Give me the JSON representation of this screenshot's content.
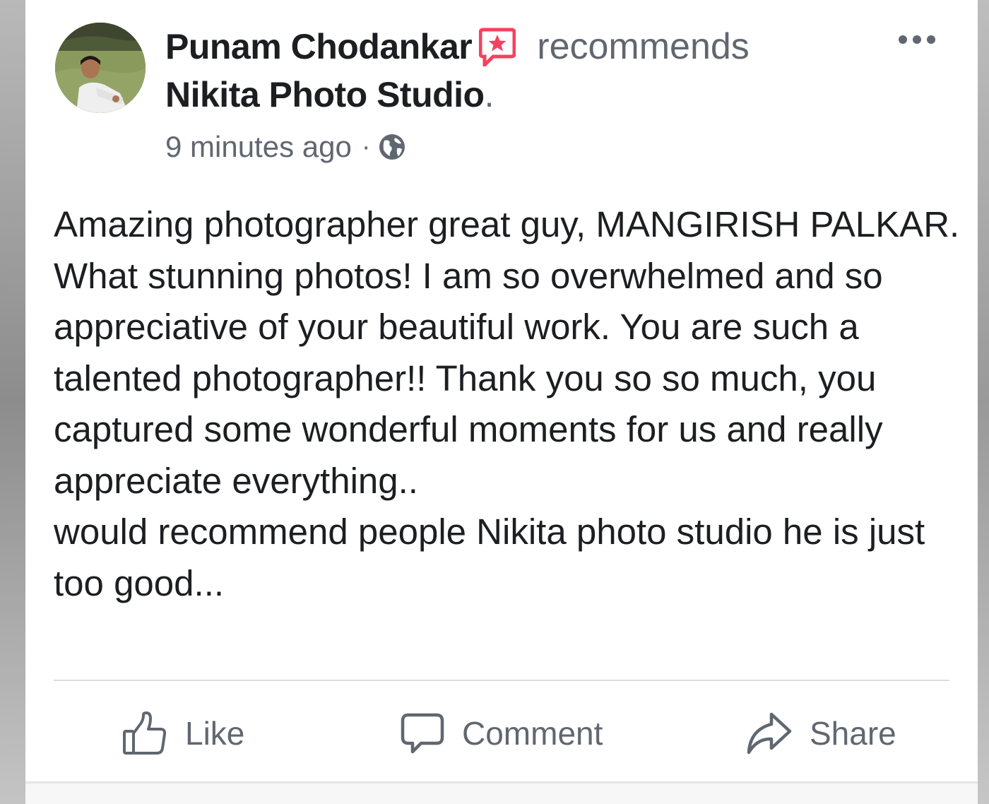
{
  "post": {
    "author": "Punam Chodankar",
    "verb": "recommends",
    "page": "Nikita Photo Studio",
    "page_suffix": ".",
    "timestamp": "9 minutes ago",
    "separator": "·",
    "audience_icon": "globe-icon",
    "recommend_icon": "star-badge-icon",
    "recommend_icon_color": "#f3425f",
    "more_icon": "more-horizontal-icon",
    "body": [
      "Amazing photographer great guy, MANGIRISH PALKAR.",
      "What stunning photos! I am so overwhelmed and so appreciative of your beautiful work. You are such a talented photographer!! Thank you so so much, you captured some wonderful moments for us and really appreciate everything..",
      "would recommend people Nikita photo studio he is just too good..."
    ]
  },
  "actions": {
    "like": {
      "label": "Like",
      "icon": "thumbs-up-icon"
    },
    "comment": {
      "label": "Comment",
      "icon": "comment-bubble-icon"
    },
    "share": {
      "label": "Share",
      "icon": "share-arrow-icon"
    }
  },
  "colors": {
    "primary_text": "#1c1e21",
    "secondary_text": "#606770",
    "divider": "#dadde1"
  }
}
